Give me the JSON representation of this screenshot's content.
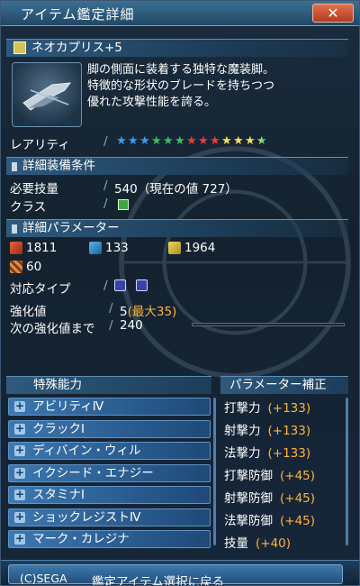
{
  "window": {
    "title": "アイテム鑑定詳細",
    "close_label": "✕"
  },
  "item": {
    "name": "ネオカプリス+5",
    "description": [
      "脚の側面に装着する独特な魔装脚。",
      "特徴的な形状のブレードを持ちつつ",
      "優れた攻撃性能を誇る。"
    ],
    "thumbnail_icon": "weapon-thumbnail"
  },
  "rarity": {
    "label": "レアリティ",
    "stars": 13,
    "star_colors": [
      "#3b9df0",
      "#3b9df0",
      "#3b9df0",
      "#35c25a",
      "#35c25a",
      "#35c25a",
      "#e83e3e",
      "#e83e3e",
      "#e83e3e",
      "#f4e25a",
      "#f4e25a",
      "#f4e25a",
      "multicolor"
    ]
  },
  "requirements": {
    "section_title": "詳細装備条件",
    "skill_label": "必要技量",
    "skill_value": "540（現在の値 727）",
    "class_label": "クラス",
    "class_icon": "braver-class-icon"
  },
  "parameters": {
    "section_title": "詳細パラメーター",
    "strike_attack": "1811",
    "ranged_attack": "133",
    "tech_attack": "1964",
    "defense": "60",
    "type_label": "対応タイプ",
    "type_icons": [
      "type-icon-a",
      "type-icon-b"
    ],
    "grind_label": "強化値",
    "grind_value": "5",
    "grind_max": "(最大35)",
    "next_grind_label": "次の強化値まで",
    "next_grind_value": "240",
    "next_grind_progress": 0
  },
  "abilities": {
    "title": "特殊能力",
    "items": [
      "アビリティⅣ",
      "クラックⅠ",
      "ディバイン・ウィル",
      "イクシード・エナジー",
      "スタミナⅠ",
      "ショックレジストⅣ",
      "マーク・カレジナ"
    ]
  },
  "param_bonus": {
    "title": "パラメーター補正",
    "items": [
      {
        "label": "打撃力",
        "value": "(+133)"
      },
      {
        "label": "射撃力",
        "value": "(+133)"
      },
      {
        "label": "法撃力",
        "value": "(+133)"
      },
      {
        "label": "打撃防御",
        "value": "(+45)"
      },
      {
        "label": "射撃防御",
        "value": "(+45)"
      },
      {
        "label": "法撃防御",
        "value": "(+45)"
      },
      {
        "label": "技量",
        "value": "(+40)"
      }
    ]
  },
  "footer": {
    "copyright": "(C)SEGA",
    "back_label": "鑑定アイテム選択に戻る"
  }
}
